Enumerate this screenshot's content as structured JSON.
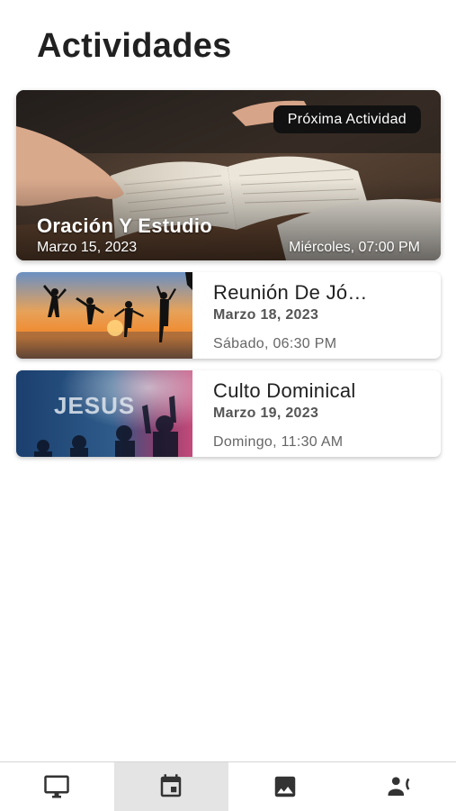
{
  "page": {
    "title": "Actividades"
  },
  "featured": {
    "badge": "Próxima Actividad",
    "title": "Oración Y Estudio",
    "date": "Marzo 15, 2023",
    "time": "Miércoles, 07:00 PM",
    "image_icon": "open-bible-image"
  },
  "activities": [
    {
      "title": "Reunión De Jó…",
      "date": "Marzo 18, 2023",
      "time": "Sábado, 06:30 PM",
      "image_icon": "youth-sunset-image"
    },
    {
      "title": "Culto Dominical",
      "date": "Marzo 19, 2023",
      "time": "Domingo, 11:30 AM",
      "image_icon": "worship-jesus-image",
      "image_text": "JESUS"
    }
  ],
  "bottom_nav": {
    "items": [
      {
        "icon": "monitor-icon",
        "active": false
      },
      {
        "icon": "calendar-icon",
        "active": true
      },
      {
        "icon": "image-icon",
        "active": false
      },
      {
        "icon": "contact-phone-icon",
        "active": false
      }
    ]
  },
  "colors": {
    "accent_dark": "#111111",
    "nav_active_bg": "#e4e4e4",
    "title": "#212121"
  }
}
